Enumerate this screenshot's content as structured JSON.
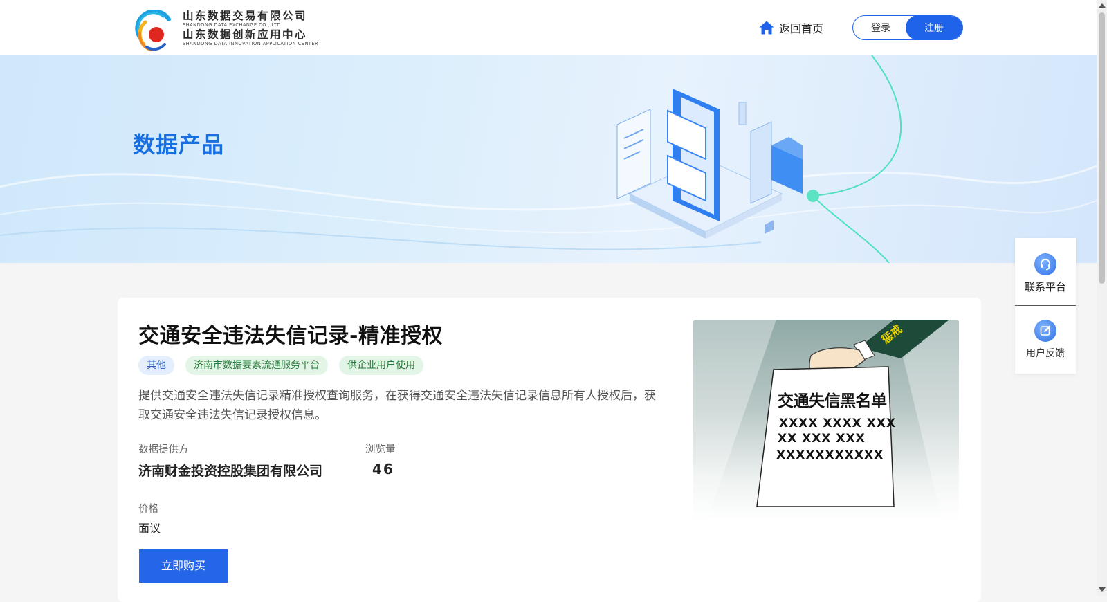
{
  "header": {
    "logo": {
      "cn_line1": "山东数据交易有限公司",
      "en_line1": "SHANDONG DATA EXCHANGE CO., LTD.",
      "cn_line2": "山东数据创新应用中心",
      "en_line2": "SHANDONG DATA INNOVATION APPLICATION CENTER"
    },
    "home_label": "返回首页",
    "home_icon": "home-icon",
    "login_label": "登录",
    "register_label": "注册"
  },
  "banner": {
    "title": "数据产品"
  },
  "product": {
    "title": "交通安全违法失信记录-精准授权",
    "tags": [
      "其他",
      "济南市数据要素流通服务平台",
      "供企业用户使用"
    ],
    "description": "提供交通安全违法失信记录精准授权查询服务，在获得交通安全违法失信记录信息所有人授权后，获取交通安全违法失信记录授权信息。",
    "provider_label": "数据提供方",
    "provider_value": "济南财金投资控股集团有限公司",
    "views_label": "浏览量",
    "views_value": "46",
    "price_label": "价格",
    "price_value": "面议",
    "buy_label": "立即购买",
    "image": {
      "sheet_title": "交通失信黑名单",
      "sheet_lines": [
        "XXXX XXXX XXX",
        "XX XXX XXX",
        "XXXXXXXXXXX"
      ],
      "sleeve_text": "惩戒"
    }
  },
  "float_panel": {
    "contact_label": "联系平台",
    "contact_icon": "headset-icon",
    "feedback_label": "用户反馈",
    "feedback_icon": "edit-icon"
  },
  "colors": {
    "primary": "#1e63e9",
    "banner_title": "#1a6fe0",
    "tag_blue_bg": "#e5eefc",
    "tag_green_bg": "#e2f5e6"
  }
}
